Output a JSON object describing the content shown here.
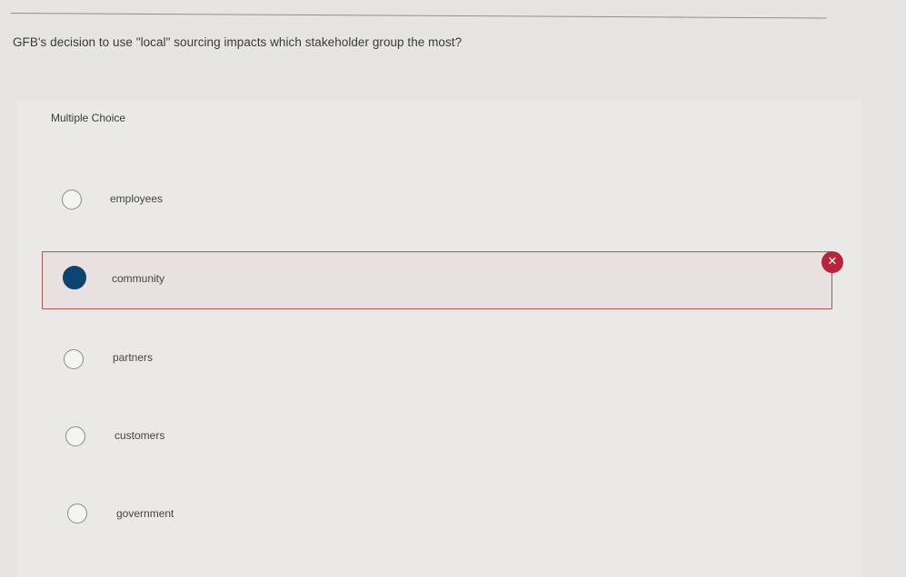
{
  "question": {
    "text": "GFB's decision to use \"local\" sourcing impacts which stakeholder group the most?"
  },
  "question_type": "Multiple Choice",
  "options": [
    {
      "label": "employees",
      "selected": false
    },
    {
      "label": "community",
      "selected": true
    },
    {
      "label": "partners",
      "selected": false
    },
    {
      "label": "customers",
      "selected": false
    },
    {
      "label": "government",
      "selected": false
    }
  ],
  "feedback": {
    "icon": "incorrect-x-icon",
    "color": "#b8243a"
  },
  "colors": {
    "selected_radio": "#0e4470",
    "selected_border": "#a35a52"
  }
}
